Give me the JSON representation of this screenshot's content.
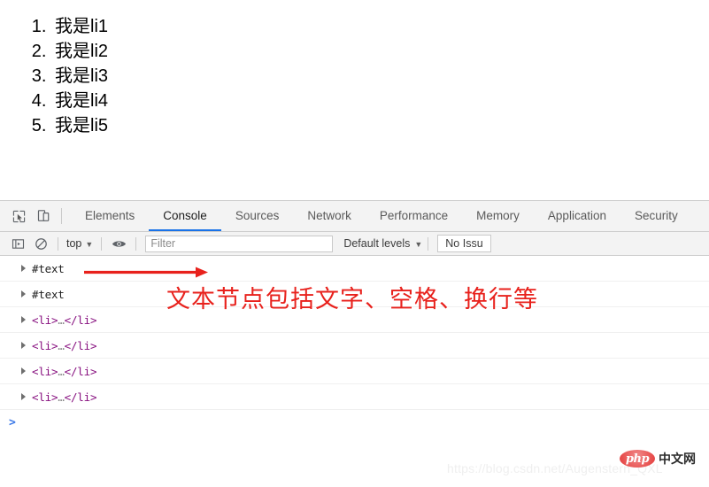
{
  "page": {
    "list_items": [
      "我是li1",
      "我是li2",
      "我是li3",
      "我是li4",
      "我是li5"
    ]
  },
  "devtools": {
    "icons": {
      "inspect": "inspect-element-icon",
      "device": "device-toolbar-icon",
      "sidebar": "console-sidebar-icon",
      "clear": "clear-console-icon",
      "eye": "live-expression-eye-icon"
    },
    "tabs": [
      {
        "label": "Elements",
        "active": false
      },
      {
        "label": "Console",
        "active": true
      },
      {
        "label": "Sources",
        "active": false
      },
      {
        "label": "Network",
        "active": false
      },
      {
        "label": "Performance",
        "active": false
      },
      {
        "label": "Memory",
        "active": false
      },
      {
        "label": "Application",
        "active": false
      },
      {
        "label": "Security",
        "active": false
      }
    ],
    "console_toolbar": {
      "context": "top",
      "context_caret": "▼",
      "filter_placeholder": "Filter",
      "filter_value": "",
      "levels_label": "Default levels",
      "levels_caret": "▼",
      "issues_label": "No Issu"
    },
    "messages": [
      {
        "type": "text-node",
        "expander": "▶",
        "content": "#text"
      },
      {
        "type": "text-node",
        "expander": "▶",
        "content": "#text"
      },
      {
        "type": "element",
        "expander": "▶",
        "open": "<li>",
        "ellipsis": "…",
        "close": "</li>"
      },
      {
        "type": "element",
        "expander": "▶",
        "open": "<li>",
        "ellipsis": "…",
        "close": "</li>"
      },
      {
        "type": "element",
        "expander": "▶",
        "open": "<li>",
        "ellipsis": "…",
        "close": "</li>"
      },
      {
        "type": "element",
        "expander": "▶",
        "open": "<li>",
        "ellipsis": "…",
        "close": "</li>"
      }
    ],
    "prompt_chevron": ">"
  },
  "annotation": {
    "text": "文本节点包括文字、空格、换行等",
    "color": "#e8211c",
    "arrow": "red-arrow-pointing-right"
  },
  "watermark": {
    "csdn_url": "https://blog.csdn.net/Augenstern_QXL",
    "php_logo_text": "php",
    "php_logo_suffix": "中文网"
  },
  "colors": {
    "accent_tab": "#1a73e8",
    "annotation_red": "#e8211c",
    "element_purple": "#881280",
    "toolbar_bg": "#f3f3f3"
  }
}
